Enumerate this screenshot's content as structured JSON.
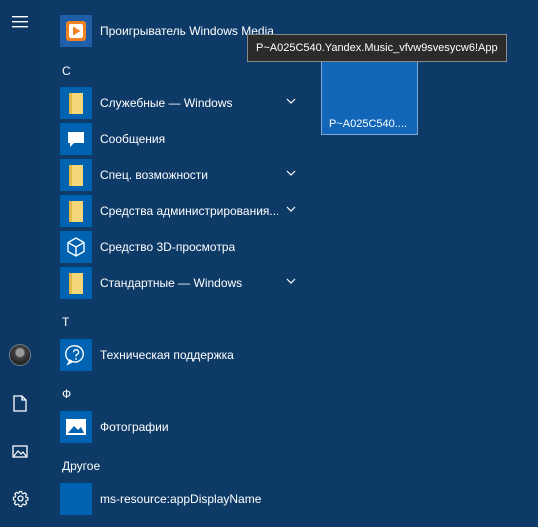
{
  "rail": {
    "menu_icon": "hamburger-icon",
    "user_icon": "avatar",
    "documents_icon": "document-icon",
    "pictures_icon": "pictures-icon",
    "settings_icon": "gear-icon"
  },
  "apps": {
    "media_player": {
      "label": "Проигрыватель Windows Media",
      "icon": "media-player-icon"
    },
    "section_c": "С",
    "system_tools": {
      "label": "Служебные — Windows",
      "icon": "folder-icon"
    },
    "messages": {
      "label": "Сообщения",
      "icon": "chat-icon"
    },
    "accessibility": {
      "label": "Спец. возможности",
      "icon": "folder-icon"
    },
    "admin_tools": {
      "label": "Средства администрирования...",
      "icon": "folder-icon"
    },
    "viewer_3d": {
      "label": "Средство 3D-просмотра",
      "icon": "cube-icon"
    },
    "accessories": {
      "label": "Стандартные — Windows",
      "icon": "folder-icon"
    },
    "section_t": "Т",
    "tech_support": {
      "label": "Техническая поддержка",
      "icon": "help-chat-icon"
    },
    "section_f": "Ф",
    "photos": {
      "label": "Фотографии",
      "icon": "photo-icon"
    },
    "section_other": "Другое",
    "ms_resource": {
      "label": "ms-resource:appDisplayName",
      "icon": "blank-tile"
    }
  },
  "tile": {
    "label": "P~A025C540....",
    "tooltip": "P~A025C540.Yandex.Music_vfvw9svesycw6!App"
  },
  "colors": {
    "background": "#0e3a67",
    "tile": "#0063b1",
    "folder": "#f5d67a",
    "tooltip_bg": "#2b2b2b"
  }
}
